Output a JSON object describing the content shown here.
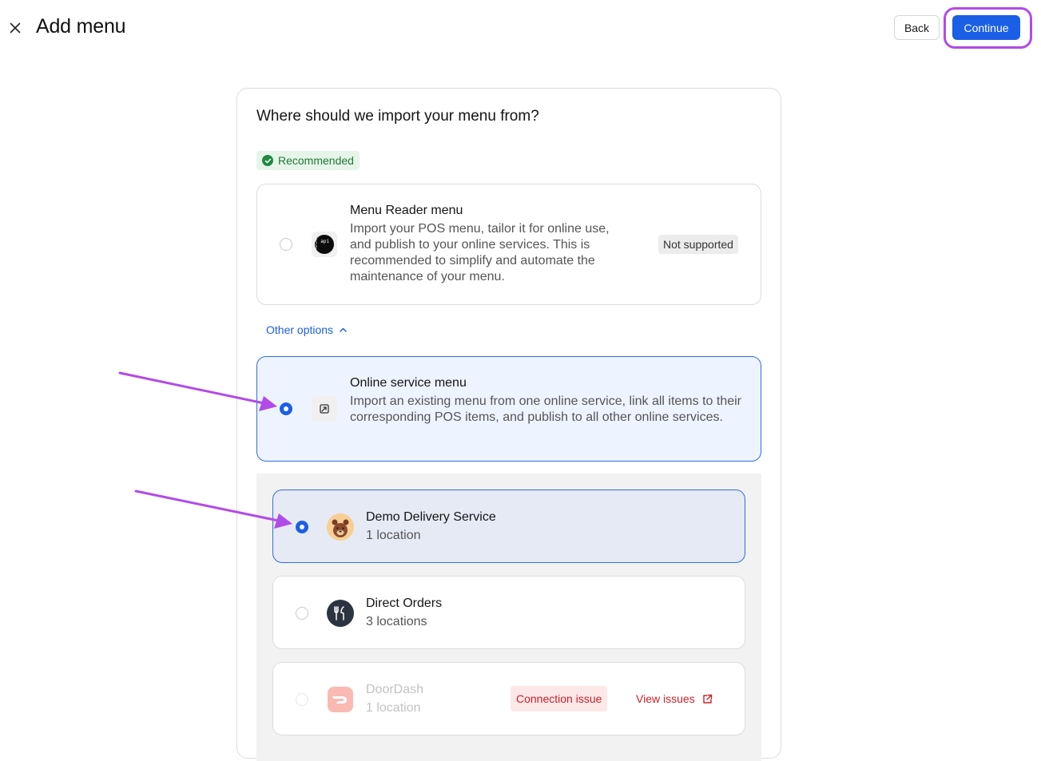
{
  "header": {
    "title": "Add menu",
    "back_label": "Back",
    "continue_label": "Continue"
  },
  "main": {
    "question": "Where should we import your menu from?",
    "recommended_label": "Recommended",
    "menu_reader": {
      "title": "Menu Reader menu",
      "description": "Import your POS menu, tailor it for online use, and publish to your online services. This is recommended to simplify and automate the maintenance of your menu.",
      "status": "Not supported",
      "icon": "api-icon",
      "icon_text": "{ api }",
      "selected": false
    },
    "other_options_label": "Other options",
    "online_service": {
      "title": "Online service menu",
      "description": "Import an existing menu from one online service, link all items to their corresponding POS items, and publish to all other online services.",
      "icon": "import-menu-icon",
      "selected": true
    },
    "services": [
      {
        "name": "Demo Delivery Service",
        "locations": "1 location",
        "icon": "bear-logo-icon",
        "selected": true,
        "disabled": false
      },
      {
        "name": "Direct Orders",
        "locations": "3 locations",
        "icon": "fork-knife-icon",
        "selected": false,
        "disabled": false
      },
      {
        "name": "DoorDash",
        "locations": "1 location",
        "icon": "doordash-logo-icon",
        "selected": false,
        "disabled": true,
        "issue_label": "Connection issue",
        "view_issues_label": "View issues"
      }
    ]
  },
  "colors": {
    "accent": "#1b5fe6",
    "annotation": "#b14be8",
    "success": "#1f7a3a",
    "error": "#c8202a"
  }
}
